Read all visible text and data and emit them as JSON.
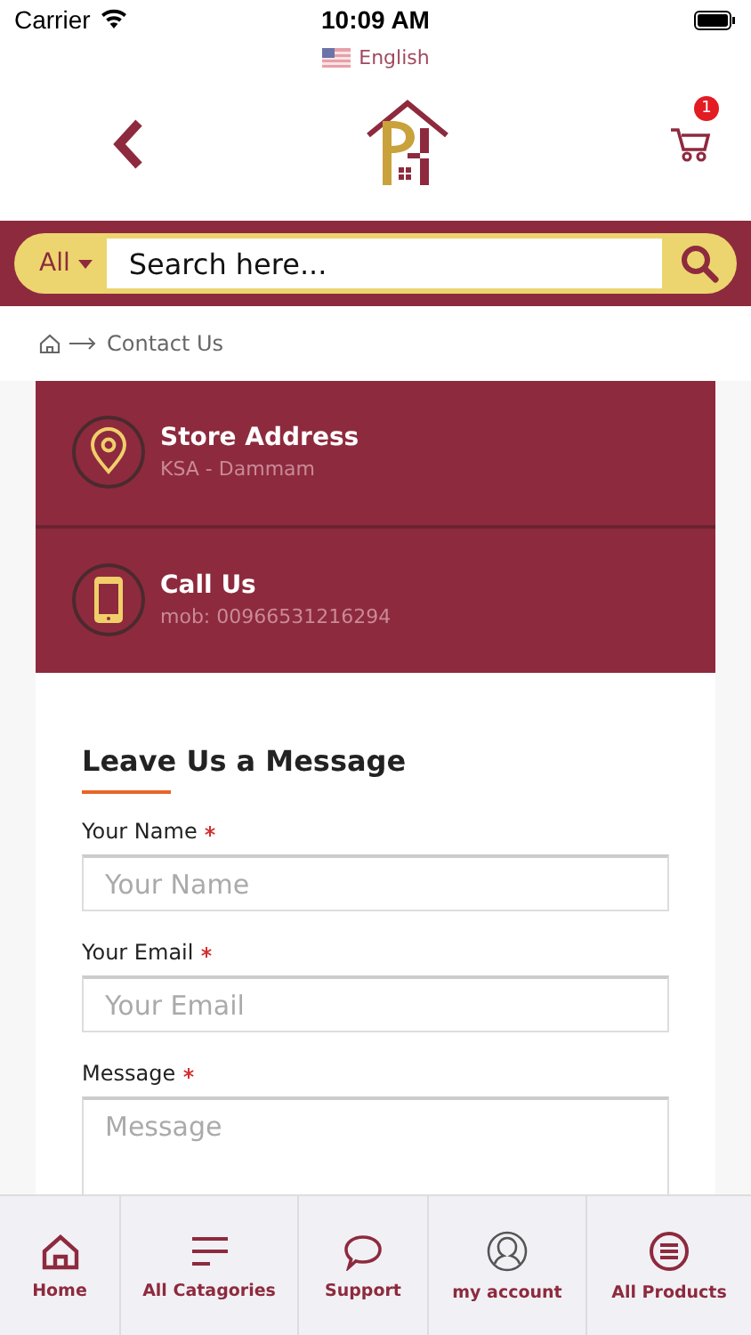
{
  "status_bar": {
    "carrier": "Carrier",
    "time": "10:09 AM"
  },
  "language": {
    "label": "English"
  },
  "header": {
    "cart_count": "1"
  },
  "search": {
    "category": "All",
    "placeholder": "Search here..."
  },
  "breadcrumb": {
    "current": "Contact Us"
  },
  "contact_items": [
    {
      "kind": "address",
      "title": "Store Address",
      "detail": "KSA - Dammam"
    },
    {
      "kind": "phone",
      "title": "Call Us",
      "detail": "mob: 00966531216294"
    }
  ],
  "form": {
    "title": "Leave Us a Message",
    "fields": [
      {
        "kind": "input",
        "label": "Your Name",
        "required": true,
        "placeholder": "Your Name"
      },
      {
        "kind": "input",
        "label": "Your Email",
        "required": true,
        "placeholder": "Your Email"
      },
      {
        "kind": "textarea",
        "label": "Message",
        "required": true,
        "placeholder": "Message"
      }
    ]
  },
  "tab_bar": [
    {
      "kind": "home",
      "label": "Home"
    },
    {
      "kind": "categories",
      "label": "All Catagories"
    },
    {
      "kind": "support",
      "label": "Support"
    },
    {
      "kind": "account",
      "label": "my account"
    },
    {
      "kind": "products",
      "label": "All Products"
    }
  ]
}
